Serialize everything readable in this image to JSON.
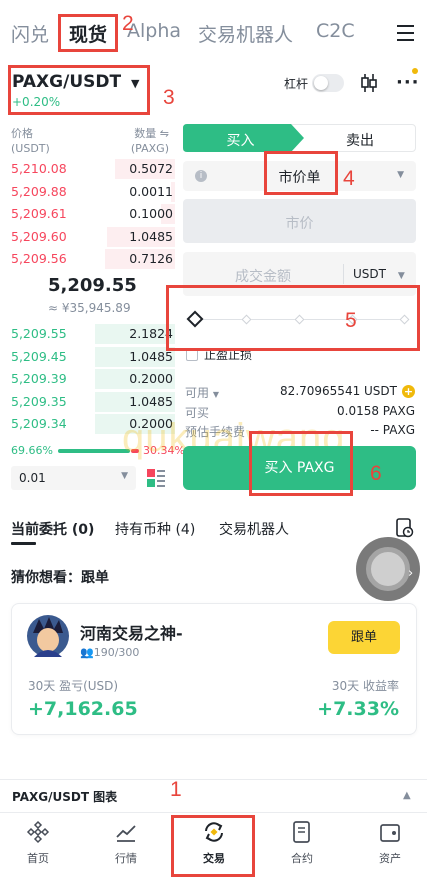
{
  "top_tabs": [
    "闪兑",
    "现货",
    "Alpha",
    "交易机器人",
    "C2C"
  ],
  "pair": {
    "name": "PAXG/USDT",
    "change": "+0.20%"
  },
  "header_right": {
    "leverage_label": "杠杆"
  },
  "orderbook": {
    "price_header": "价格",
    "price_unit": "(USDT)",
    "qty_header": "数量",
    "qty_unit": "(PAXG)",
    "asks": [
      {
        "price": "5,210.08",
        "qty": "0.5072"
      },
      {
        "price": "5,209.88",
        "qty": "0.0011"
      },
      {
        "price": "5,209.61",
        "qty": "0.1000"
      },
      {
        "price": "5,209.60",
        "qty": "1.0485"
      },
      {
        "price": "5,209.56",
        "qty": "0.7126"
      }
    ],
    "last_price": "5,209.55",
    "last_price_cny": "≈ ¥35,945.89",
    "bids": [
      {
        "price": "5,209.55",
        "qty": "2.1824"
      },
      {
        "price": "5,209.45",
        "qty": "1.0485"
      },
      {
        "price": "5,209.39",
        "qty": "0.2000"
      },
      {
        "price": "5,209.35",
        "qty": "1.0485"
      },
      {
        "price": "5,209.34",
        "qty": "0.2000"
      }
    ],
    "buy_ratio": "69.66%",
    "sell_ratio": "30.34%",
    "precision": "0.01"
  },
  "form": {
    "buy_tab": "买入",
    "sell_tab": "卖出",
    "order_type": "市价单",
    "price_placeholder": "市价",
    "amount_placeholder": "成交金额",
    "amount_unit": "USDT",
    "tpsl_label": "止盈止损",
    "available_label": "可用",
    "available_value": "82.70965541 USDT",
    "can_buy_label": "可买",
    "can_buy_value": "0.0158 PAXG",
    "fee_label": "预估手续费",
    "fee_value": "-- PAXG",
    "submit": "买入 PAXG"
  },
  "watermark": "qukuaiwang",
  "section_tabs": [
    {
      "label": "当前委托 (0)"
    },
    {
      "label": "持有币种 (4)"
    },
    {
      "label": "交易机器人"
    }
  ],
  "guess": {
    "title": "猜你想看：跟单"
  },
  "copy_card": {
    "trader_name": "河南交易之神-",
    "followers": "190/300",
    "follow_button": "跟单",
    "pnl_label": "30天 盈亏(USD)",
    "pnl_value": "+7,162.65",
    "roi_label": "30天 收益率",
    "roi_value": "+7.33%"
  },
  "chart_bar": {
    "label": "PAXG/USDT 图表"
  },
  "bottom_nav": [
    {
      "label": "首页"
    },
    {
      "label": "行情"
    },
    {
      "label": "交易"
    },
    {
      "label": "合约"
    },
    {
      "label": "资产"
    }
  ],
  "annotations": [
    "1",
    "2",
    "3",
    "4",
    "5",
    "6"
  ],
  "colors": {
    "buy_green": "#2ebd85",
    "sell_red": "#f6465d",
    "annotation_red": "#e8453c",
    "follow_yellow": "#fcd535"
  }
}
